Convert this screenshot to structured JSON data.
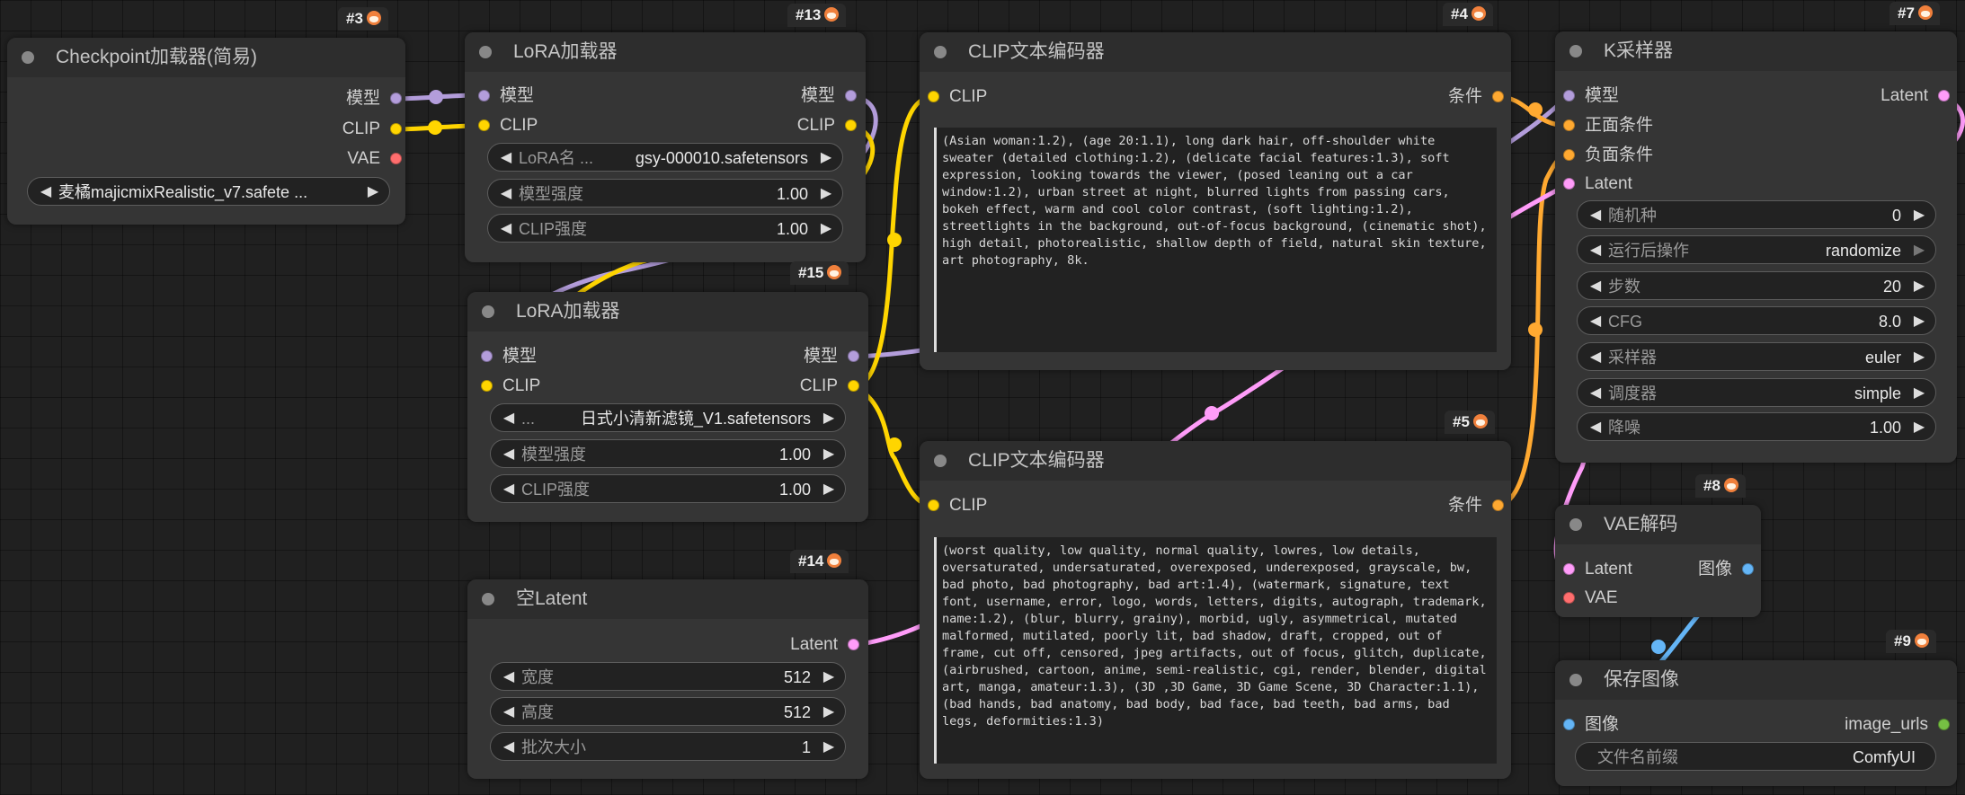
{
  "colors": {
    "model": "#b39ddb",
    "clip": "#ffd500",
    "vae": "#ff6e6e",
    "conditioning": "#ffa931",
    "latent": "#ff9cf9",
    "image": "#64b5f6",
    "string_out": "#76c043"
  },
  "nodes": {
    "checkpoint": {
      "id_badge": "#3",
      "title": "Checkpoint加载器(简易)",
      "outputs": [
        "模型",
        "CLIP",
        "VAE"
      ],
      "ckpt_value": "麦橘majicmixRealistic_v7.safete ..."
    },
    "lora13": {
      "id_badge": "#13",
      "title": "LoRA加载器",
      "inputs": [
        "模型",
        "CLIP"
      ],
      "outputs": [
        "模型",
        "CLIP"
      ],
      "lora_label": "LoRA名 ...",
      "lora_value": "gsy-000010.safetensors",
      "strength_model_label": "模型强度",
      "strength_model": "1.00",
      "strength_clip_label": "CLIP强度",
      "strength_clip": "1.00"
    },
    "lora15": {
      "id_badge": "#15",
      "title": "LoRA加载器",
      "inputs": [
        "模型",
        "CLIP"
      ],
      "outputs": [
        "模型",
        "CLIP"
      ],
      "lora_label": "...",
      "lora_value": "日式小清新滤镜_V1.safetensors",
      "strength_model_label": "模型强度",
      "strength_model": "1.00",
      "strength_clip_label": "CLIP强度",
      "strength_clip": "1.00"
    },
    "clip4": {
      "id_badge": "#4",
      "title": "CLIP文本编码器",
      "input": "CLIP",
      "output": "条件",
      "text": "(Asian woman:1.2), (age 20:1.1), long dark hair, off-shoulder white sweater (detailed clothing:1.2), (delicate facial features:1.3), soft expression, looking towards the viewer, (posed leaning out a car window:1.2), urban street at night, blurred lights from passing cars, bokeh effect, warm and cool color contrast, (soft lighting:1.2), streetlights in the background, out-of-focus background, (cinematic shot), high detail, photorealistic, shallow depth of field, natural skin texture, art photography, 8k."
    },
    "clip5": {
      "id_badge": "#5",
      "title": "CLIP文本编码器",
      "input": "CLIP",
      "output": "条件",
      "text": "(worst quality, low quality, normal quality, lowres, low details, oversaturated, undersaturated, overexposed, underexposed, grayscale, bw, bad photo, bad photography, bad art:1.4), (watermark, signature, text font, username, error, logo, words, letters, digits, autograph, trademark, name:1.2), (blur, blurry, grainy), morbid, ugly, asymmetrical, mutated malformed, mutilated, poorly lit, bad shadow, draft, cropped, out of frame, cut off, censored, jpeg artifacts, out of focus, glitch, duplicate, (airbrushed, cartoon, anime, semi-realistic, cgi, render, blender, digital art, manga, amateur:1.3), (3D ,3D Game, 3D Game Scene, 3D Character:1.1), (bad hands, bad anatomy, bad body, bad face, bad teeth, bad arms, bad legs, deformities:1.3)"
    },
    "ksampler": {
      "id_badge": "#7",
      "title": "K采样器",
      "inputs": [
        "模型",
        "正面条件",
        "负面条件",
        "Latent"
      ],
      "output": "Latent",
      "widgets": [
        {
          "label": "随机种",
          "value": "0"
        },
        {
          "label": "运行后操作",
          "value": "randomize"
        },
        {
          "label": "步数",
          "value": "20"
        },
        {
          "label": "CFG",
          "value": "8.0"
        },
        {
          "label": "采样器",
          "value": "euler"
        },
        {
          "label": "调度器",
          "value": "simple"
        },
        {
          "label": "降噪",
          "value": "1.00"
        }
      ]
    },
    "empty_latent": {
      "id_badge": "#14",
      "title": "空Latent",
      "output": "Latent",
      "widgets": [
        {
          "label": "宽度",
          "value": "512"
        },
        {
          "label": "高度",
          "value": "512"
        },
        {
          "label": "批次大小",
          "value": "1"
        }
      ]
    },
    "vae_decode": {
      "id_badge": "#8",
      "title": "VAE解码",
      "inputs": [
        "Latent",
        "VAE"
      ],
      "output": "图像"
    },
    "save_image": {
      "id_badge": "#9",
      "title": "保存图像",
      "input": "图像",
      "output": "image_urls",
      "prefix_label": "文件名前缀",
      "prefix_value": "ComfyUI"
    }
  }
}
